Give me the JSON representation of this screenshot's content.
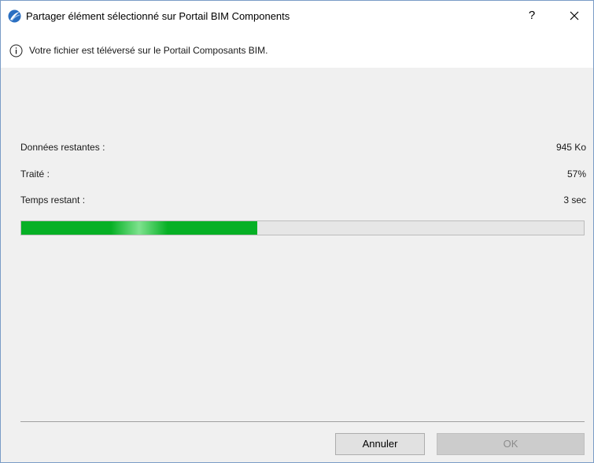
{
  "window": {
    "title": "Partager élément sélectionné sur Portail BIM Components",
    "help_label": "?"
  },
  "info": {
    "message": "Votre fichier est téléversé sur le Portail Composants BIM."
  },
  "stats": {
    "remaining_data_label": "Données restantes :",
    "remaining_data_value": "945 Ko",
    "processed_label": "Traité :",
    "processed_value": "57%",
    "time_remaining_label": "Temps restant :",
    "time_remaining_value": "3 sec"
  },
  "progress": {
    "fraction": 0.42,
    "color": "#06b025"
  },
  "buttons": {
    "cancel_label": "Annuler",
    "ok_label": "OK"
  },
  "icons": {
    "app": "archicad-logo-icon",
    "info": "info-icon",
    "close": "close-icon"
  }
}
